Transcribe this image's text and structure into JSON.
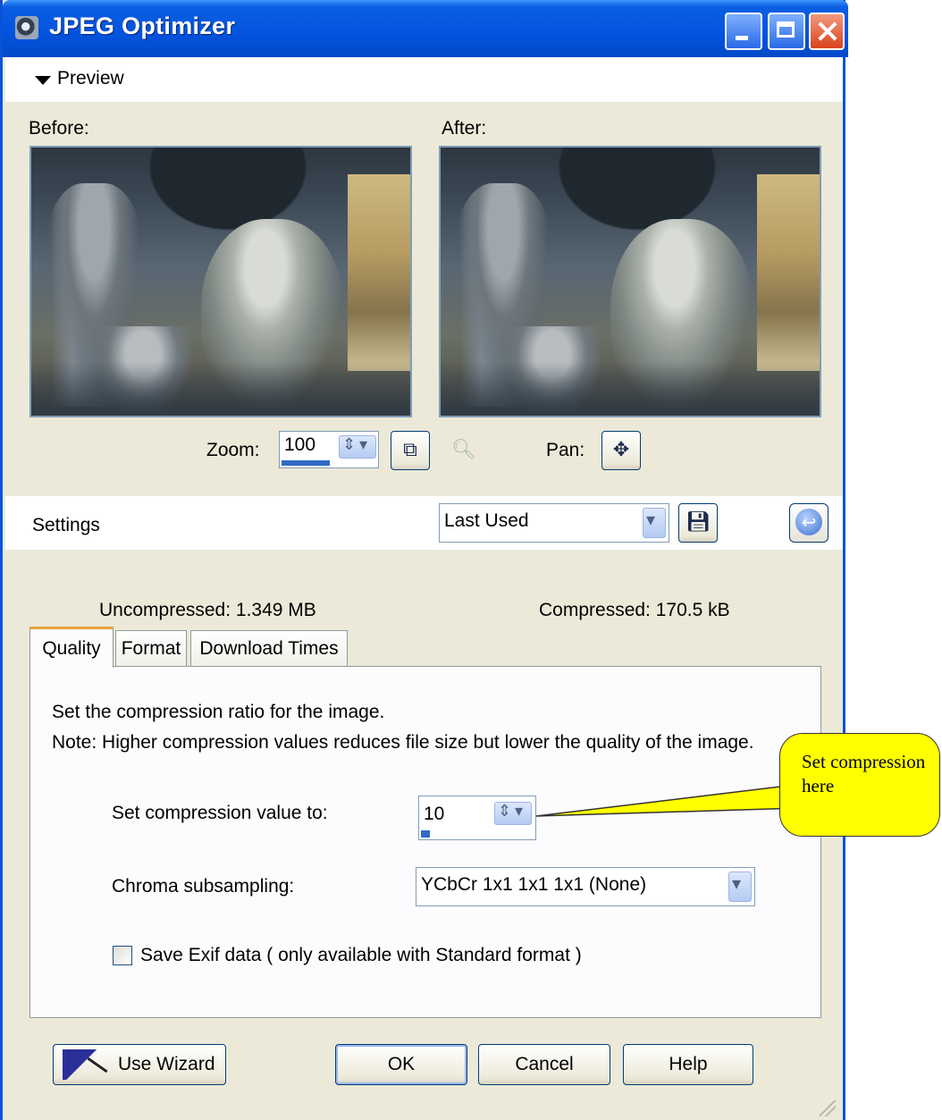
{
  "window": {
    "title": "JPEG Optimizer"
  },
  "preview": {
    "header_label": "Preview",
    "before_label": "Before:",
    "after_label": "After:",
    "zoom_label": "Zoom:",
    "zoom_value": "100",
    "pan_label": "Pan:"
  },
  "settings": {
    "label": "Settings",
    "preset_value": "Last Used"
  },
  "sizes": {
    "uncompressed": "Uncompressed:  1.349 MB",
    "compressed": "Compressed: 170.5 kB"
  },
  "tabs": [
    {
      "label": "Quality",
      "active": true
    },
    {
      "label": "Format",
      "active": false
    },
    {
      "label": "Download Times",
      "active": false
    }
  ],
  "quality": {
    "description": "Set the compression ratio for the image.",
    "note": "Note:  Higher compression values reduces file size but lower the quality of the image.",
    "compression_label": "Set compression value to:",
    "compression_value": "10",
    "chroma_label": "Chroma subsampling:",
    "chroma_value": "YCbCr  1x1  1x1  1x1  (None)",
    "exif_label": "Save Exif data ( only available with Standard format )",
    "exif_checked": false
  },
  "buttons": {
    "wizard": "Use Wizard",
    "ok": "OK",
    "cancel": "Cancel",
    "help": "Help"
  },
  "callout": {
    "text": "Set compression here"
  },
  "icons": [
    "window-app-icon",
    "minimize-icon",
    "maximize-icon",
    "close-icon",
    "collapse-arrow-icon",
    "zoom-fit-icon",
    "zoom-magnifier-icon",
    "pan-move-icon",
    "save-preset-icon",
    "reset-icon",
    "wizard-icon",
    "resize-grip-icon"
  ]
}
